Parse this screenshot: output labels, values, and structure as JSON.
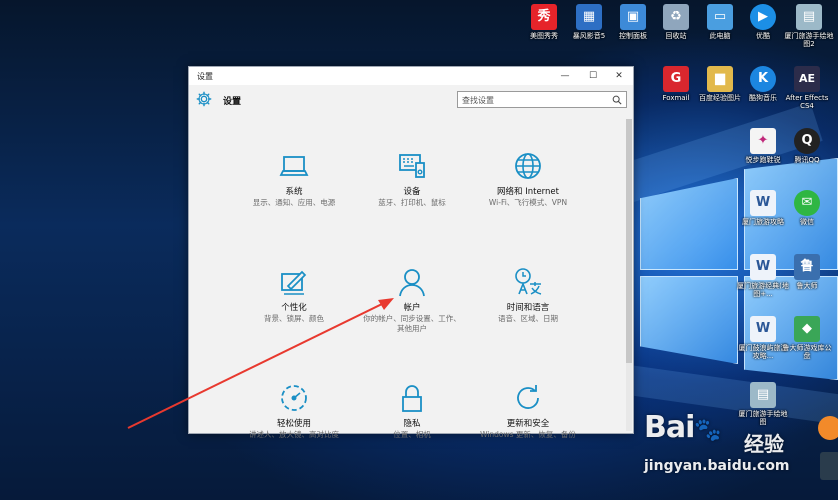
{
  "desktop": {
    "icons": [
      {
        "label": "美图秀秀",
        "icon": "meitu-icon",
        "color": "#e6242a",
        "glyph": "秀"
      },
      {
        "label": "暴风影音5",
        "icon": "baofeng-icon",
        "color": "#2d6fc4",
        "glyph": "▦"
      },
      {
        "label": "控制面板",
        "icon": "control-panel-icon",
        "color": "#3d8ad8",
        "glyph": "▣"
      },
      {
        "label": "回收站",
        "icon": "recycle-bin-icon",
        "color": "#8fa6bd",
        "glyph": "♻"
      },
      {
        "label": "此电脑",
        "icon": "computer-icon",
        "color": "#4a9ee0",
        "glyph": "▭"
      },
      {
        "label": "优酷",
        "icon": "youku-icon",
        "color": "#1c8fe6",
        "glyph": "▶"
      },
      {
        "label": "厦门旅游手绘地图2",
        "icon": "map-file-icon",
        "color": "#9cb9c8",
        "glyph": "▤"
      },
      {
        "label": "Foxmail",
        "icon": "foxmail-icon",
        "color": "#d9272e",
        "glyph": "G"
      },
      {
        "label": "百度经验图片",
        "icon": "folder-icon",
        "color": "#e2b94c",
        "glyph": "▆"
      },
      {
        "label": "酷狗音乐",
        "icon": "kugou-icon",
        "color": "#1c86e0",
        "glyph": "K"
      },
      {
        "label": "After Effects CS4",
        "icon": "after-effects-icon",
        "color": "#2c2c4a",
        "glyph": "AE"
      },
      {
        "label": "悦步跑鞋锐",
        "icon": "shoe-brand-icon",
        "color": "#f4f4f4",
        "glyph": "✦"
      },
      {
        "label": "腾讯QQ",
        "icon": "qq-icon",
        "color": "#222222",
        "glyph": "Q"
      },
      {
        "label": "厦门旅游攻略",
        "icon": "word-doc-icon",
        "color": "#eef3fa",
        "glyph": "W"
      },
      {
        "label": "微信",
        "icon": "wechat-icon",
        "color": "#2fb643",
        "glyph": "✉"
      },
      {
        "label": "厦门旅游经典(地图+...",
        "icon": "word-doc-icon",
        "color": "#eef3fa",
        "glyph": "W"
      },
      {
        "label": "鲁大师",
        "icon": "ludashi-icon",
        "color": "#3a6fae",
        "glyph": "鲁"
      },
      {
        "label": "厦门鼓浪屿旅游攻略...",
        "icon": "word-doc-icon",
        "color": "#eef3fa",
        "glyph": "W"
      },
      {
        "label": "鲁大师游戏库公盘",
        "icon": "ludashi-game-icon",
        "color": "#3aa657",
        "glyph": "◆"
      },
      {
        "label": "厦门旅游手绘地图",
        "icon": "map-file-icon",
        "color": "#9cb9c8",
        "glyph": "▤"
      }
    ]
  },
  "window": {
    "title": "设置",
    "controls": {
      "minimize": "—",
      "maximize": "☐",
      "close": "✕"
    },
    "header_title": "设置",
    "search": {
      "placeholder": "查找设置"
    },
    "tiles": [
      {
        "title": "系统",
        "subtitle": "显示、通知、应用、电源",
        "icon": "laptop-icon"
      },
      {
        "title": "设备",
        "subtitle": "蓝牙、打印机、鼠标",
        "icon": "devices-icon"
      },
      {
        "title": "网络和 Internet",
        "subtitle": "Wi-Fi、飞行模式、VPN",
        "icon": "globe-icon"
      },
      {
        "title": "个性化",
        "subtitle": "背景、锁屏、颜色",
        "icon": "personalization-icon"
      },
      {
        "title": "帐户",
        "subtitle": "你的帐户、同步设置、工作、其他用户",
        "icon": "person-icon"
      },
      {
        "title": "时间和语言",
        "subtitle": "语音、区域、日期",
        "icon": "time-language-icon"
      },
      {
        "title": "轻松使用",
        "subtitle": "讲述人、放大镜、高对比度",
        "icon": "ease-of-access-icon"
      },
      {
        "title": "隐私",
        "subtitle": "位置、相机",
        "icon": "lock-icon"
      },
      {
        "title": "更新和安全",
        "subtitle": "Windows 更新、恢复、备份",
        "icon": "update-icon"
      }
    ]
  },
  "watermark": {
    "brand": "Bai",
    "paw": "du",
    "jingyan": "经验",
    "url": "jingyan.baidu.com"
  },
  "colors": {
    "accent": "#1a8fc5",
    "arrow": "#e8392f",
    "window_bg": "#f2f2f2"
  }
}
